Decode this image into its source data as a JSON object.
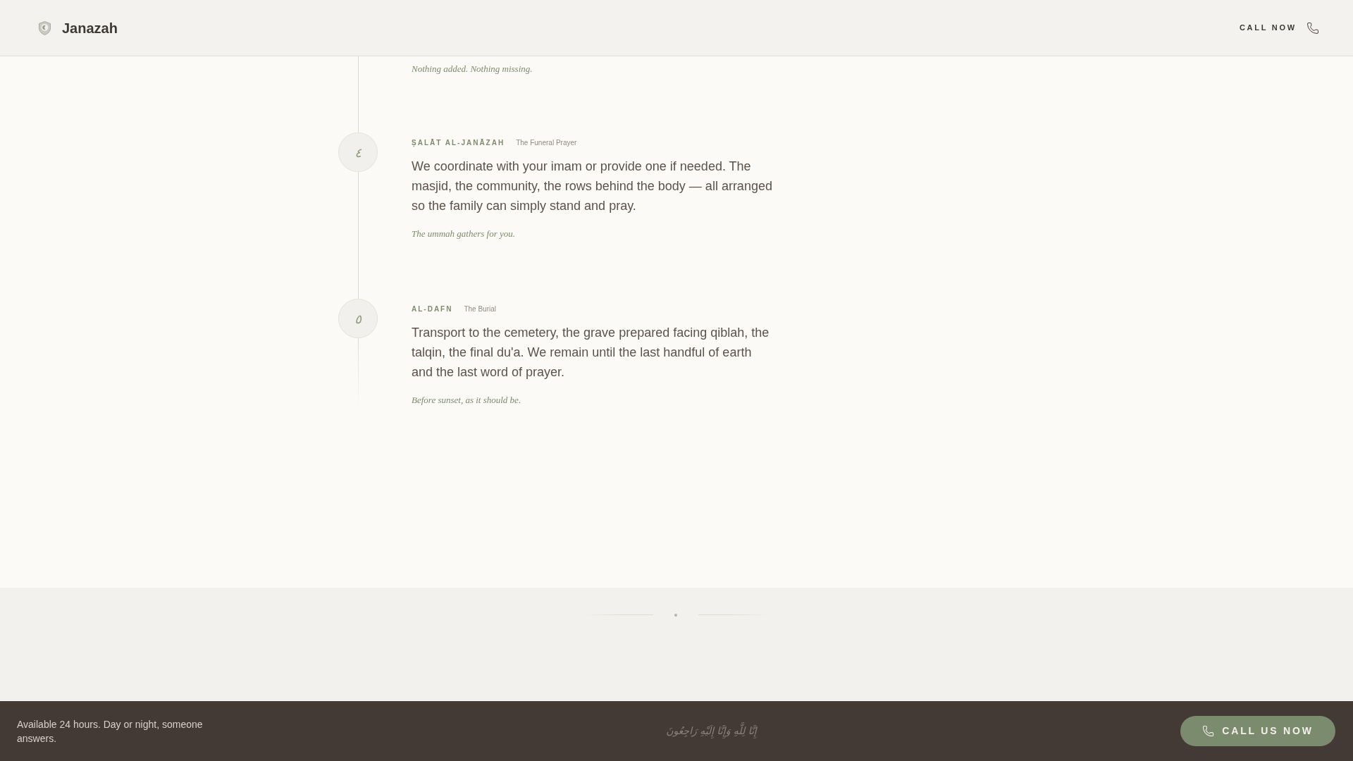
{
  "header": {
    "brand": "Janazah",
    "call_link": "CALL NOW"
  },
  "timeline": {
    "steps": [
      {
        "kind": "partial",
        "tagline": "Nothing added. Nothing missing."
      },
      {
        "kind": "full",
        "numeral": "٤",
        "title": "ṢALĀT AL-JANĀZAH",
        "subtitle": "The Funeral Prayer",
        "body": "We coordinate with your imam or provide one if needed. The masjid, the community, the rows behind the body — all arranged so the family can simply stand and pray.",
        "tagline": "The ummah gathers for you."
      },
      {
        "kind": "full",
        "numeral": "٥",
        "title": "AL-DAFN",
        "subtitle": "The Burial",
        "body": "Transport to the cemetery, the grave prepared facing qiblah, the talqin, the final du'a. We remain until the last handful of earth and the last word of prayer.",
        "tagline": "Before sunset, as it should be."
      }
    ]
  },
  "footer": {
    "availability": "Available 24 hours. Day or night, someone answers.",
    "arabic_phrase": "إِنَّا لِلَّهِ وَإِنَّا إِلَيْهِ رَاجِعُونَ",
    "call_button": "CALL US NOW"
  }
}
